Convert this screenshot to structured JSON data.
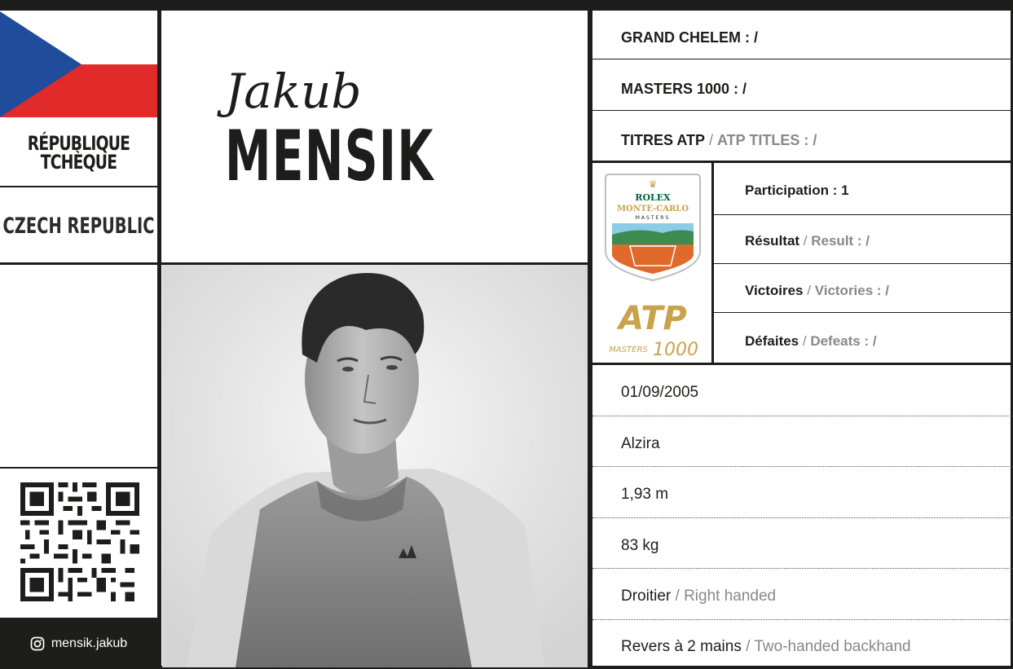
{
  "country": {
    "name_fr": "RÉPUBLIQUE TCHÈQUE",
    "name_en": "CZECH REPUBLIC",
    "flag_colors": {
      "top": "#ffffff",
      "bottom": "#e12a2a",
      "triangle": "#1f4d9c"
    }
  },
  "player": {
    "first_name": "Jakub",
    "last_name": "MENSIK"
  },
  "social": {
    "icon": "instagram-icon",
    "handle": "mensik.jakub"
  },
  "records": {
    "grand_chelem": "GRAND CHELEM : /",
    "masters_1000": "MASTERS 1000 : /",
    "titres_fr": "TITRES ATP",
    "titres_sep": " / ",
    "titres_en": "ATP TITLES : /"
  },
  "tournament": {
    "logo_rolex": "ROLEX",
    "logo_name": "MONTE-CARLO",
    "logo_masters": "MASTERS",
    "atp_logo": "ATP",
    "atp_masters": "MASTERS",
    "atp_1000": "1000",
    "participation": "Participation : 1",
    "result_fr": "Résultat",
    "result_en": "Result : /",
    "victories_fr": "Victoires",
    "victories_en": "Victories : /",
    "defeats_fr": "Défaites",
    "defeats_en": "Defeats : /",
    "separator": " / "
  },
  "bio": {
    "birth_date": "01/09/2005",
    "residence": "Alzira",
    "height": "1,93 m",
    "weight": "83 kg",
    "hand_fr": "Droitier",
    "hand_en": "Right handed",
    "backhand_fr": "Revers à 2 mains",
    "backhand_en": "Two-handed backhand",
    "separator": " / "
  },
  "colors": {
    "ink": "#1d1d1b",
    "secondary_text": "#888888",
    "gold": "#c9a24c",
    "clay": "#e06a2c"
  }
}
